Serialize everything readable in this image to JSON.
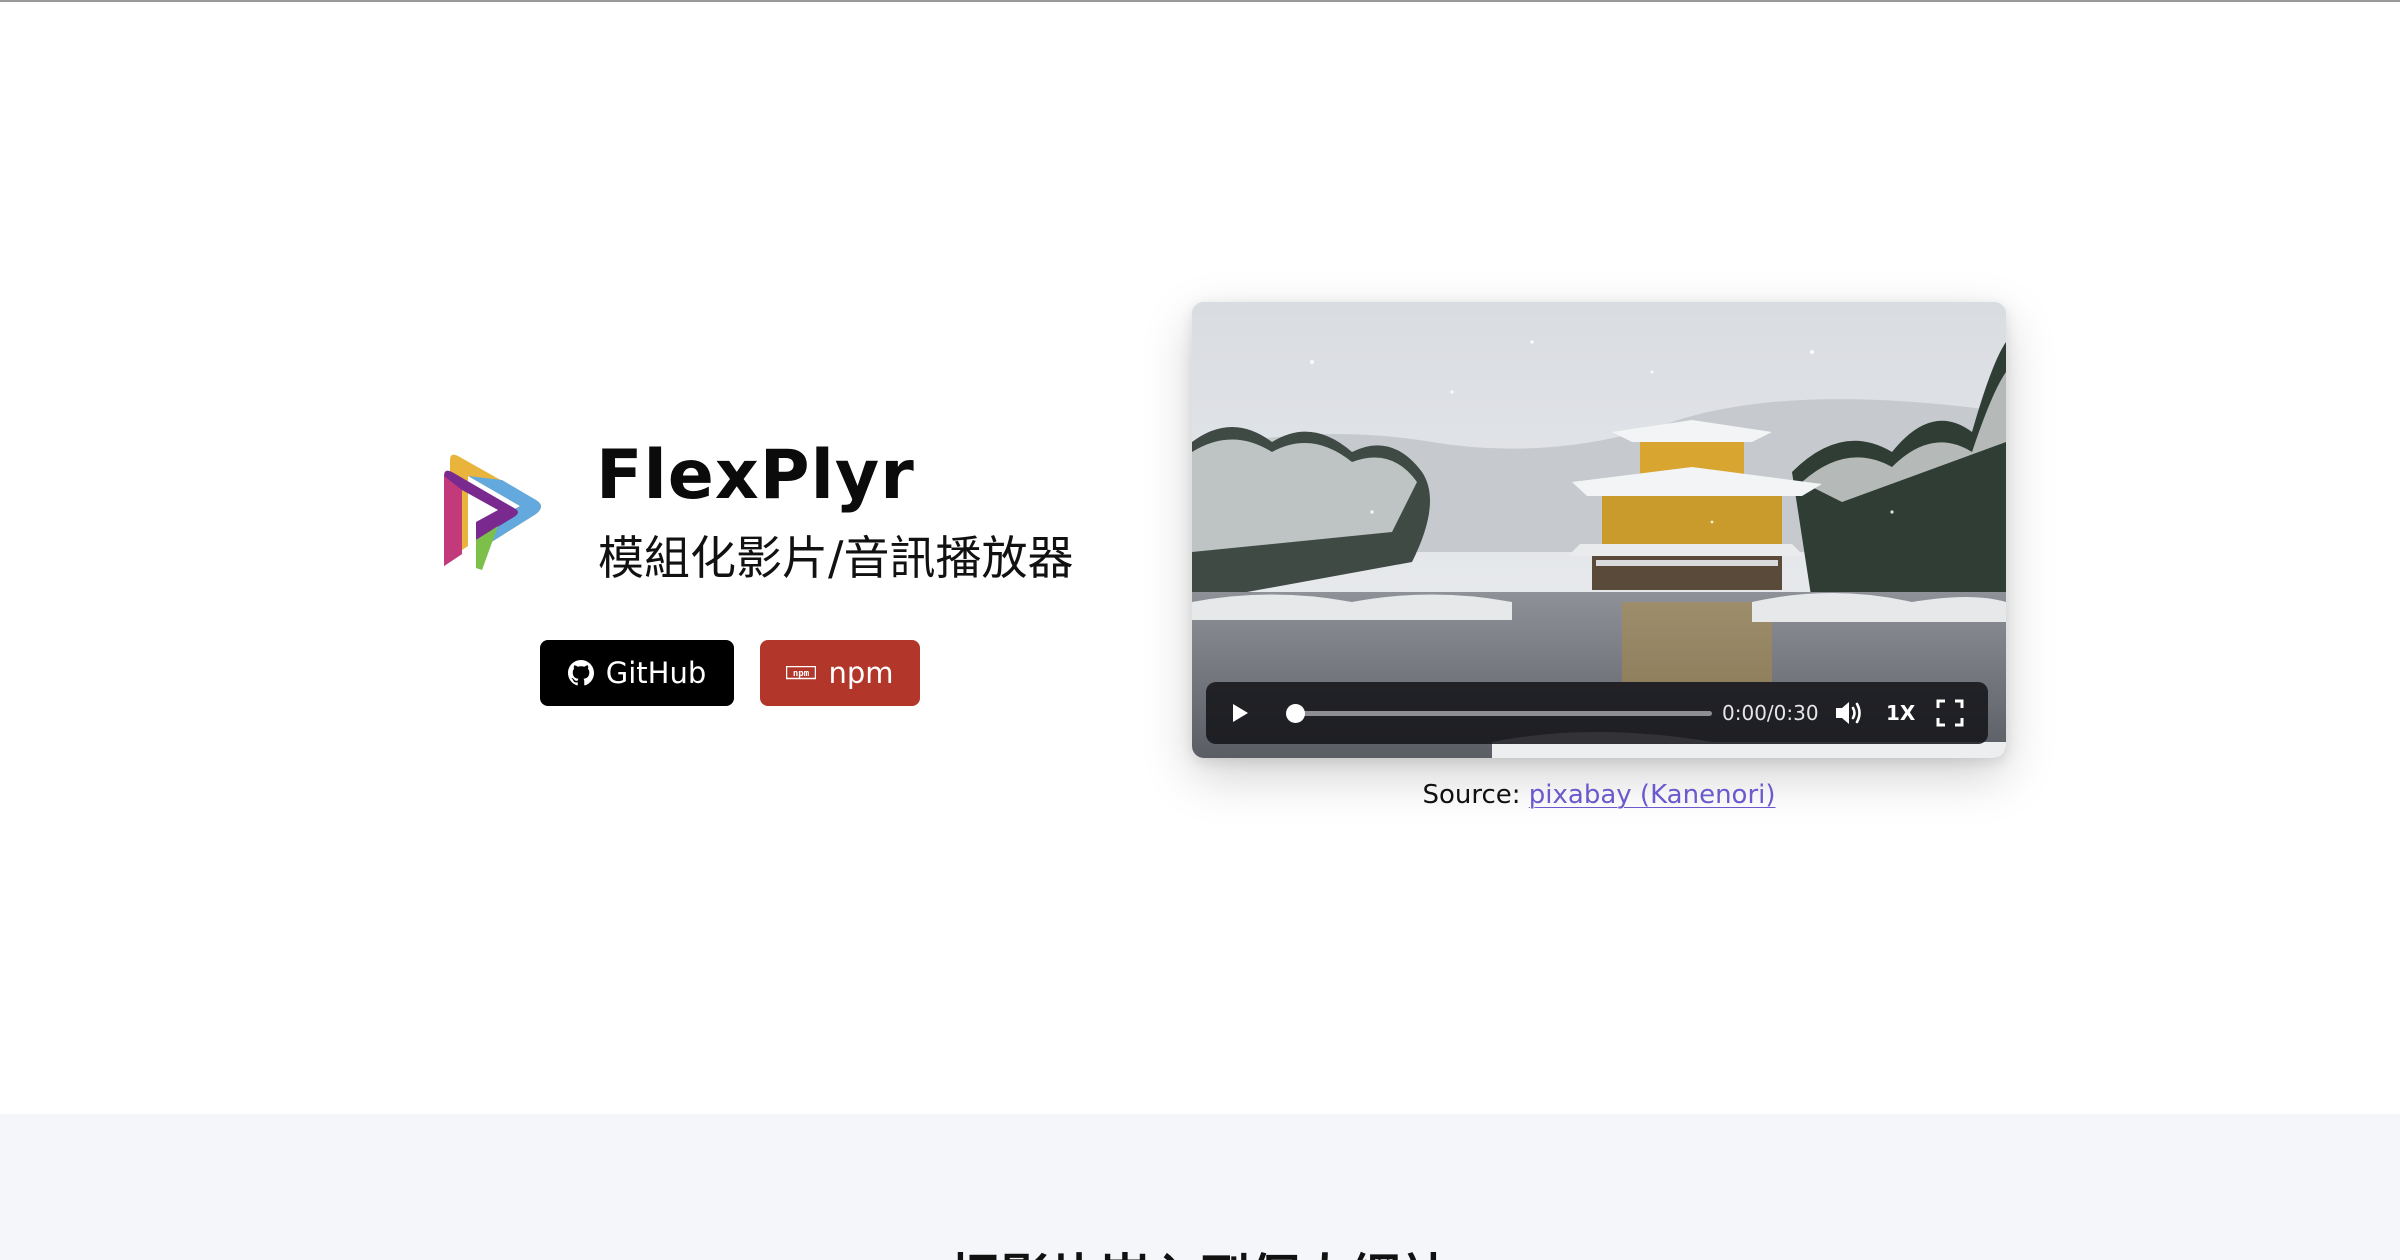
{
  "brand": {
    "name": "FlexPlyr",
    "subtitle": "模組化影片/音訊播放器"
  },
  "buttons": {
    "github_label": "GitHub",
    "npm_label": "npm",
    "npm_icon_text": "npm"
  },
  "player": {
    "time": "0:00/0:30",
    "speed": "1X",
    "progress": 0
  },
  "source": {
    "prefix": "Source: ",
    "link_label": "pixabay (Kanenori)"
  },
  "lower_section": {
    "heading": "把影片嵌入到個人網站"
  },
  "colors": {
    "github_bg": "#000000",
    "npm_bg": "#b2372a",
    "link": "#6a5acd",
    "lower_bg": "#f5f6fa"
  },
  "icons": [
    "flexplyr-logo",
    "github-icon",
    "npm-icon",
    "play-icon",
    "volume-icon",
    "fullscreen-icon"
  ]
}
